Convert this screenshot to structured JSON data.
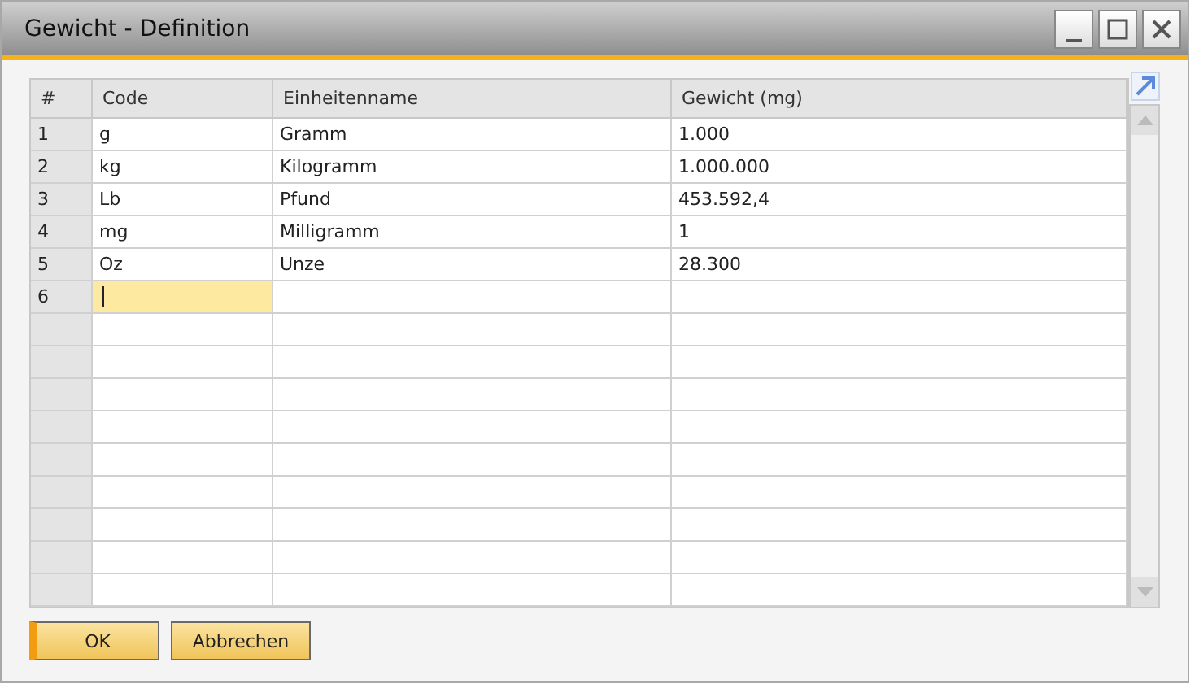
{
  "window": {
    "title": "Gewicht - Definition"
  },
  "table": {
    "columns": [
      "#",
      "Code",
      "Einheitenname",
      "Gewicht (mg)"
    ],
    "rows": [
      {
        "number": "1",
        "code": "g",
        "name": "Gramm",
        "weight": "1.000",
        "selected": false
      },
      {
        "number": "2",
        "code": "kg",
        "name": "Kilogramm",
        "weight": "1.000.000",
        "selected": false
      },
      {
        "number": "3",
        "code": "Lb",
        "name": "Pfund",
        "weight": "453.592,4",
        "selected": false
      },
      {
        "number": "4",
        "code": "mg",
        "name": "Milligramm",
        "weight": "1",
        "selected": false
      },
      {
        "number": "5",
        "code": "Oz",
        "name": "Unze",
        "weight": "28.300",
        "selected": false
      },
      {
        "number": "6",
        "selected": true
      }
    ]
  },
  "buttons": [
    {
      "label": "OK",
      "kind": "default"
    },
    {
      "label": "Abbrechen",
      "kind": "normal"
    }
  ]
}
